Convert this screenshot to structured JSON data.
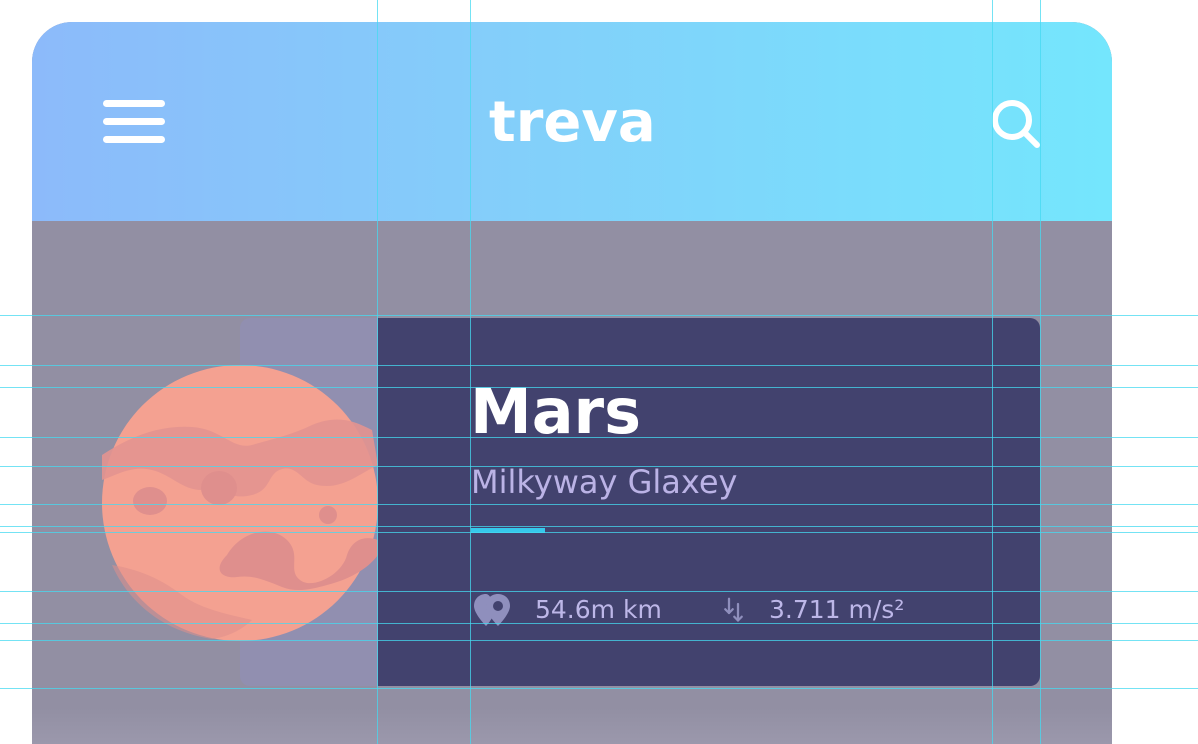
{
  "app": {
    "brand": "treva"
  },
  "header": {
    "menu_icon": "hamburger-menu-icon",
    "search_icon": "search-icon",
    "gradient_start": "#8cbafa",
    "gradient_end": "#74e6fd"
  },
  "planet_card": {
    "name": "Mars",
    "galaxy": "Milkyway Glaxey",
    "distance": "54.6m km",
    "distance_icon": "location-pins-icon",
    "gravity": "3.711 m/s²",
    "gravity_icon": "gravity-arrows-icon",
    "accent_color": "#36c8ec",
    "card_color": "#42426e",
    "planet_color": "#f4a191"
  }
}
